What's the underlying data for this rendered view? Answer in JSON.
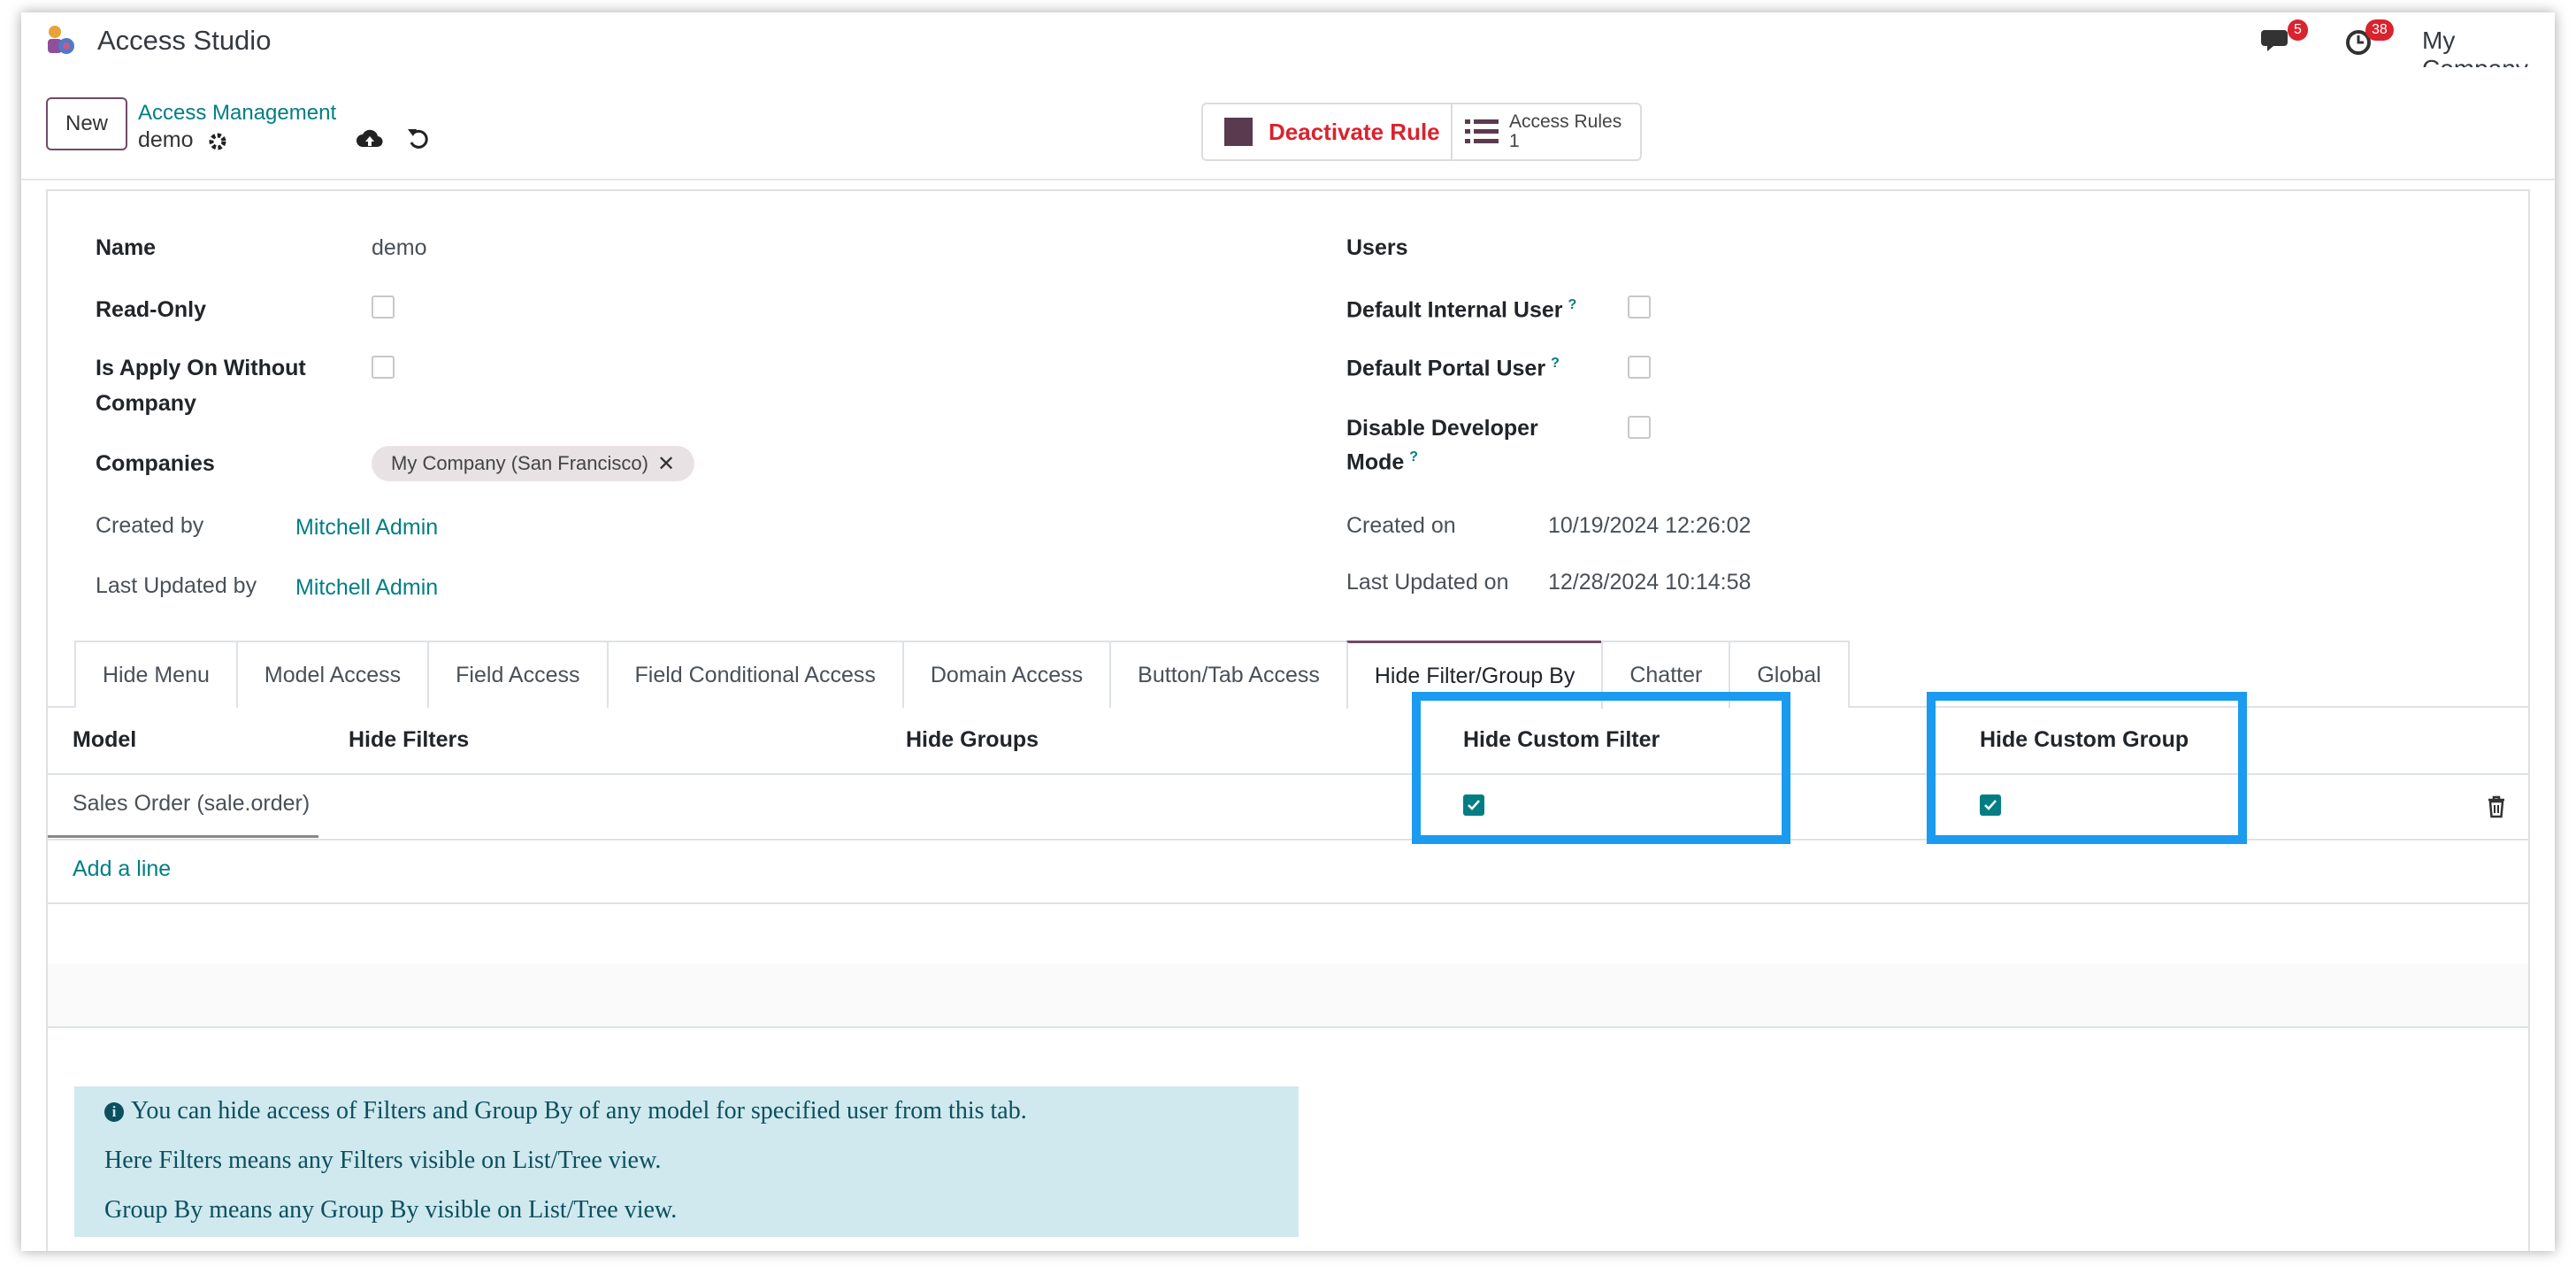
{
  "navbar": {
    "app_title": "Access Studio",
    "chat_badge": "5",
    "activity_badge": "38",
    "company": "My Company",
    "icons": [
      "app-logo",
      "chat-icon",
      "clock-icon"
    ]
  },
  "control": {
    "new_label": "New",
    "breadcrumb": "Access Management",
    "record_name": "demo",
    "deactivate_label": "Deactivate Rule",
    "access_rules_label": "Access Rules",
    "access_rules_count": "1"
  },
  "form": {
    "name_label": "Name",
    "name_value": "demo",
    "readonly_label": "Read-Only",
    "apply_without_company_label_1": "Is Apply On Without",
    "apply_without_company_label_2": "Company",
    "companies_label": "Companies",
    "company_tag": "My Company (San Francisco)",
    "created_by_label": "Created by",
    "created_by_value": "Mitchell Admin",
    "last_updated_by_label": "Last Updated by",
    "last_updated_by_value": "Mitchell Admin",
    "users_label": "Users",
    "default_internal_user_label": "Default Internal User",
    "default_portal_user_label": "Default Portal User",
    "disable_dev_mode_label_1": "Disable Developer",
    "disable_dev_mode_label_2": "Mode",
    "help_mark": "?",
    "created_on_label": "Created on",
    "created_on_value": "10/19/2024 12:26:02",
    "last_updated_on_label": "Last Updated on",
    "last_updated_on_value": "12/28/2024 10:14:58"
  },
  "tabs": [
    {
      "label": "Hide Menu"
    },
    {
      "label": "Model Access"
    },
    {
      "label": "Field Access"
    },
    {
      "label": "Field Conditional Access"
    },
    {
      "label": "Domain Access"
    },
    {
      "label": "Button/Tab Access"
    },
    {
      "label": "Hide Filter/Group By"
    },
    {
      "label": "Chatter"
    },
    {
      "label": "Global"
    }
  ],
  "active_tab": "Hide Filter/Group By",
  "table": {
    "columns": [
      "Model",
      "Hide Filters",
      "Hide Groups",
      "Hide Custom Filter",
      "Hide Custom Group"
    ],
    "rows": [
      {
        "model": "Sales Order (sale.order)",
        "hide_filters": "",
        "hide_groups": "",
        "hide_custom_filter": true,
        "hide_custom_group": true
      }
    ],
    "add_line": "Add a line"
  },
  "info": {
    "line1": "You can hide access of Filters and Group By of any model for specified user from this tab.",
    "line2": "Here Filters means any Filters visible on List/Tree view.",
    "line3": "Group By means any Group By visible on List/Tree view."
  },
  "colors": {
    "brand": "#714b67",
    "link": "#017e84",
    "danger": "#d9232e",
    "highlight": "#1a9bf0",
    "info_bg": "#cfe9ef"
  }
}
